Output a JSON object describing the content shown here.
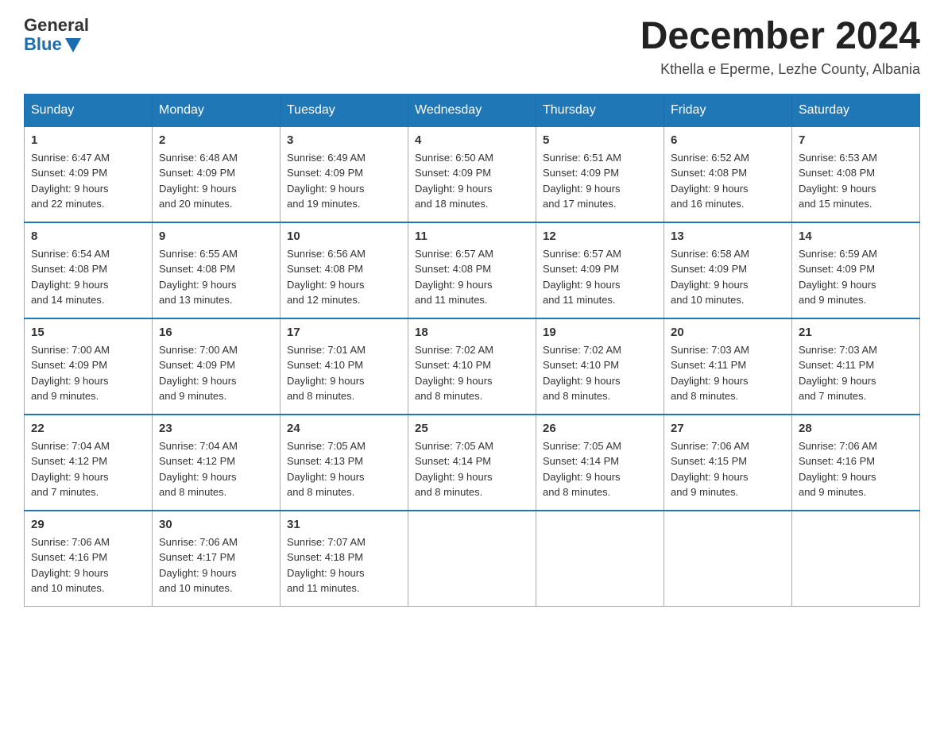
{
  "header": {
    "logo_general": "General",
    "logo_blue": "Blue",
    "title": "December 2024",
    "subtitle": "Kthella e Eperme, Lezhe County, Albania"
  },
  "days_of_week": [
    "Sunday",
    "Monday",
    "Tuesday",
    "Wednesday",
    "Thursday",
    "Friday",
    "Saturday"
  ],
  "weeks": [
    [
      {
        "day": "1",
        "sunrise": "6:47 AM",
        "sunset": "4:09 PM",
        "daylight": "9 hours and 22 minutes."
      },
      {
        "day": "2",
        "sunrise": "6:48 AM",
        "sunset": "4:09 PM",
        "daylight": "9 hours and 20 minutes."
      },
      {
        "day": "3",
        "sunrise": "6:49 AM",
        "sunset": "4:09 PM",
        "daylight": "9 hours and 19 minutes."
      },
      {
        "day": "4",
        "sunrise": "6:50 AM",
        "sunset": "4:09 PM",
        "daylight": "9 hours and 18 minutes."
      },
      {
        "day": "5",
        "sunrise": "6:51 AM",
        "sunset": "4:09 PM",
        "daylight": "9 hours and 17 minutes."
      },
      {
        "day": "6",
        "sunrise": "6:52 AM",
        "sunset": "4:08 PM",
        "daylight": "9 hours and 16 minutes."
      },
      {
        "day": "7",
        "sunrise": "6:53 AM",
        "sunset": "4:08 PM",
        "daylight": "9 hours and 15 minutes."
      }
    ],
    [
      {
        "day": "8",
        "sunrise": "6:54 AM",
        "sunset": "4:08 PM",
        "daylight": "9 hours and 14 minutes."
      },
      {
        "day": "9",
        "sunrise": "6:55 AM",
        "sunset": "4:08 PM",
        "daylight": "9 hours and 13 minutes."
      },
      {
        "day": "10",
        "sunrise": "6:56 AM",
        "sunset": "4:08 PM",
        "daylight": "9 hours and 12 minutes."
      },
      {
        "day": "11",
        "sunrise": "6:57 AM",
        "sunset": "4:08 PM",
        "daylight": "9 hours and 11 minutes."
      },
      {
        "day": "12",
        "sunrise": "6:57 AM",
        "sunset": "4:09 PM",
        "daylight": "9 hours and 11 minutes."
      },
      {
        "day": "13",
        "sunrise": "6:58 AM",
        "sunset": "4:09 PM",
        "daylight": "9 hours and 10 minutes."
      },
      {
        "day": "14",
        "sunrise": "6:59 AM",
        "sunset": "4:09 PM",
        "daylight": "9 hours and 9 minutes."
      }
    ],
    [
      {
        "day": "15",
        "sunrise": "7:00 AM",
        "sunset": "4:09 PM",
        "daylight": "9 hours and 9 minutes."
      },
      {
        "day": "16",
        "sunrise": "7:00 AM",
        "sunset": "4:09 PM",
        "daylight": "9 hours and 9 minutes."
      },
      {
        "day": "17",
        "sunrise": "7:01 AM",
        "sunset": "4:10 PM",
        "daylight": "9 hours and 8 minutes."
      },
      {
        "day": "18",
        "sunrise": "7:02 AM",
        "sunset": "4:10 PM",
        "daylight": "9 hours and 8 minutes."
      },
      {
        "day": "19",
        "sunrise": "7:02 AM",
        "sunset": "4:10 PM",
        "daylight": "9 hours and 8 minutes."
      },
      {
        "day": "20",
        "sunrise": "7:03 AM",
        "sunset": "4:11 PM",
        "daylight": "9 hours and 8 minutes."
      },
      {
        "day": "21",
        "sunrise": "7:03 AM",
        "sunset": "4:11 PM",
        "daylight": "9 hours and 7 minutes."
      }
    ],
    [
      {
        "day": "22",
        "sunrise": "7:04 AM",
        "sunset": "4:12 PM",
        "daylight": "9 hours and 7 minutes."
      },
      {
        "day": "23",
        "sunrise": "7:04 AM",
        "sunset": "4:12 PM",
        "daylight": "9 hours and 8 minutes."
      },
      {
        "day": "24",
        "sunrise": "7:05 AM",
        "sunset": "4:13 PM",
        "daylight": "9 hours and 8 minutes."
      },
      {
        "day": "25",
        "sunrise": "7:05 AM",
        "sunset": "4:14 PM",
        "daylight": "9 hours and 8 minutes."
      },
      {
        "day": "26",
        "sunrise": "7:05 AM",
        "sunset": "4:14 PM",
        "daylight": "9 hours and 8 minutes."
      },
      {
        "day": "27",
        "sunrise": "7:06 AM",
        "sunset": "4:15 PM",
        "daylight": "9 hours and 9 minutes."
      },
      {
        "day": "28",
        "sunrise": "7:06 AM",
        "sunset": "4:16 PM",
        "daylight": "9 hours and 9 minutes."
      }
    ],
    [
      {
        "day": "29",
        "sunrise": "7:06 AM",
        "sunset": "4:16 PM",
        "daylight": "9 hours and 10 minutes."
      },
      {
        "day": "30",
        "sunrise": "7:06 AM",
        "sunset": "4:17 PM",
        "daylight": "9 hours and 10 minutes."
      },
      {
        "day": "31",
        "sunrise": "7:07 AM",
        "sunset": "4:18 PM",
        "daylight": "9 hours and 11 minutes."
      },
      null,
      null,
      null,
      null
    ]
  ],
  "labels": {
    "sunrise": "Sunrise:",
    "sunset": "Sunset:",
    "daylight": "Daylight:"
  }
}
